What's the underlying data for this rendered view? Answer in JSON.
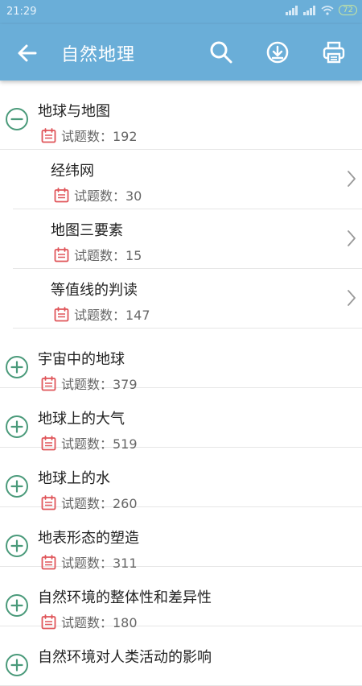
{
  "status": {
    "time": "21:29",
    "battery": "72"
  },
  "appbar": {
    "title": "自然地理"
  },
  "meta_label": "试题数：",
  "sections": [
    {
      "name": "地球与地图",
      "count": "192",
      "expanded": true,
      "children": [
        {
          "name": "经纬网",
          "count": "30"
        },
        {
          "name": "地图三要素",
          "count": "15"
        },
        {
          "name": "等值线的判读",
          "count": "147"
        }
      ]
    },
    {
      "name": "宇宙中的地球",
      "count": "379",
      "expanded": false
    },
    {
      "name": "地球上的大气",
      "count": "519",
      "expanded": false
    },
    {
      "name": "地球上的水",
      "count": "260",
      "expanded": false
    },
    {
      "name": "地表形态的塑造",
      "count": "311",
      "expanded": false
    },
    {
      "name": "自然环境的整体性和差异性",
      "count": "180",
      "expanded": false
    },
    {
      "name": "自然环境对人类活动的影响",
      "count": "",
      "expanded": false
    }
  ],
  "colors": {
    "accent": "#6aaed8",
    "icon_green": "#4a9a7a",
    "icon_red": "#e0555a"
  }
}
